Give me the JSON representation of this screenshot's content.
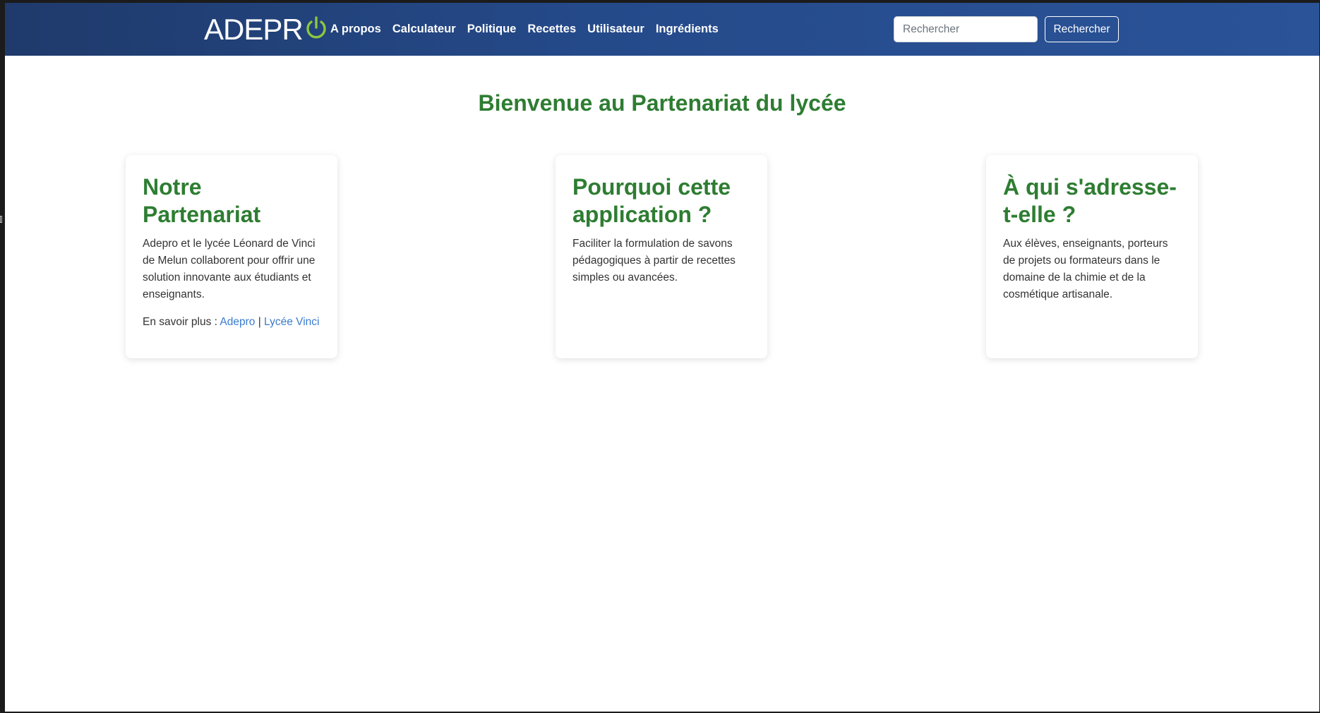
{
  "navbar": {
    "logo_text": "ADEPR",
    "links": [
      "A propos",
      "Calculateur",
      "Politique",
      "Recettes",
      "Utilisateur",
      "Ingrédients"
    ],
    "search_placeholder": "Rechercher",
    "search_button": "Rechercher"
  },
  "main": {
    "title": "Bienvenue au Partenariat du lycée",
    "cards": [
      {
        "title": "Notre Partenariat",
        "text": "Adepro et le lycée Léonard de Vinci de Melun collaborent pour offrir une solution innovante aux étudiants et enseignants.",
        "more_label": "En savoir plus : ",
        "link1": "Adepro",
        "separator": " | ",
        "link2": "Lycée Vinci"
      },
      {
        "title": "Pourquoi cette application ?",
        "text": "Faciliter la formulation de savons pédagogiques à partir de recettes simples ou avancées."
      },
      {
        "title": "À qui s'adresse-t-elle ?",
        "text": "Aux élèves, enseignants, porteurs de projets ou formateurs dans le domaine de la chimie et de la cosmétique artisanale."
      }
    ]
  },
  "colors": {
    "navbar": "#254a8a",
    "accent_green": "#2e7d32",
    "logo_power": "#8dc63f",
    "link": "#3b7bd0"
  },
  "icons": {
    "logo_power": "power-icon"
  }
}
